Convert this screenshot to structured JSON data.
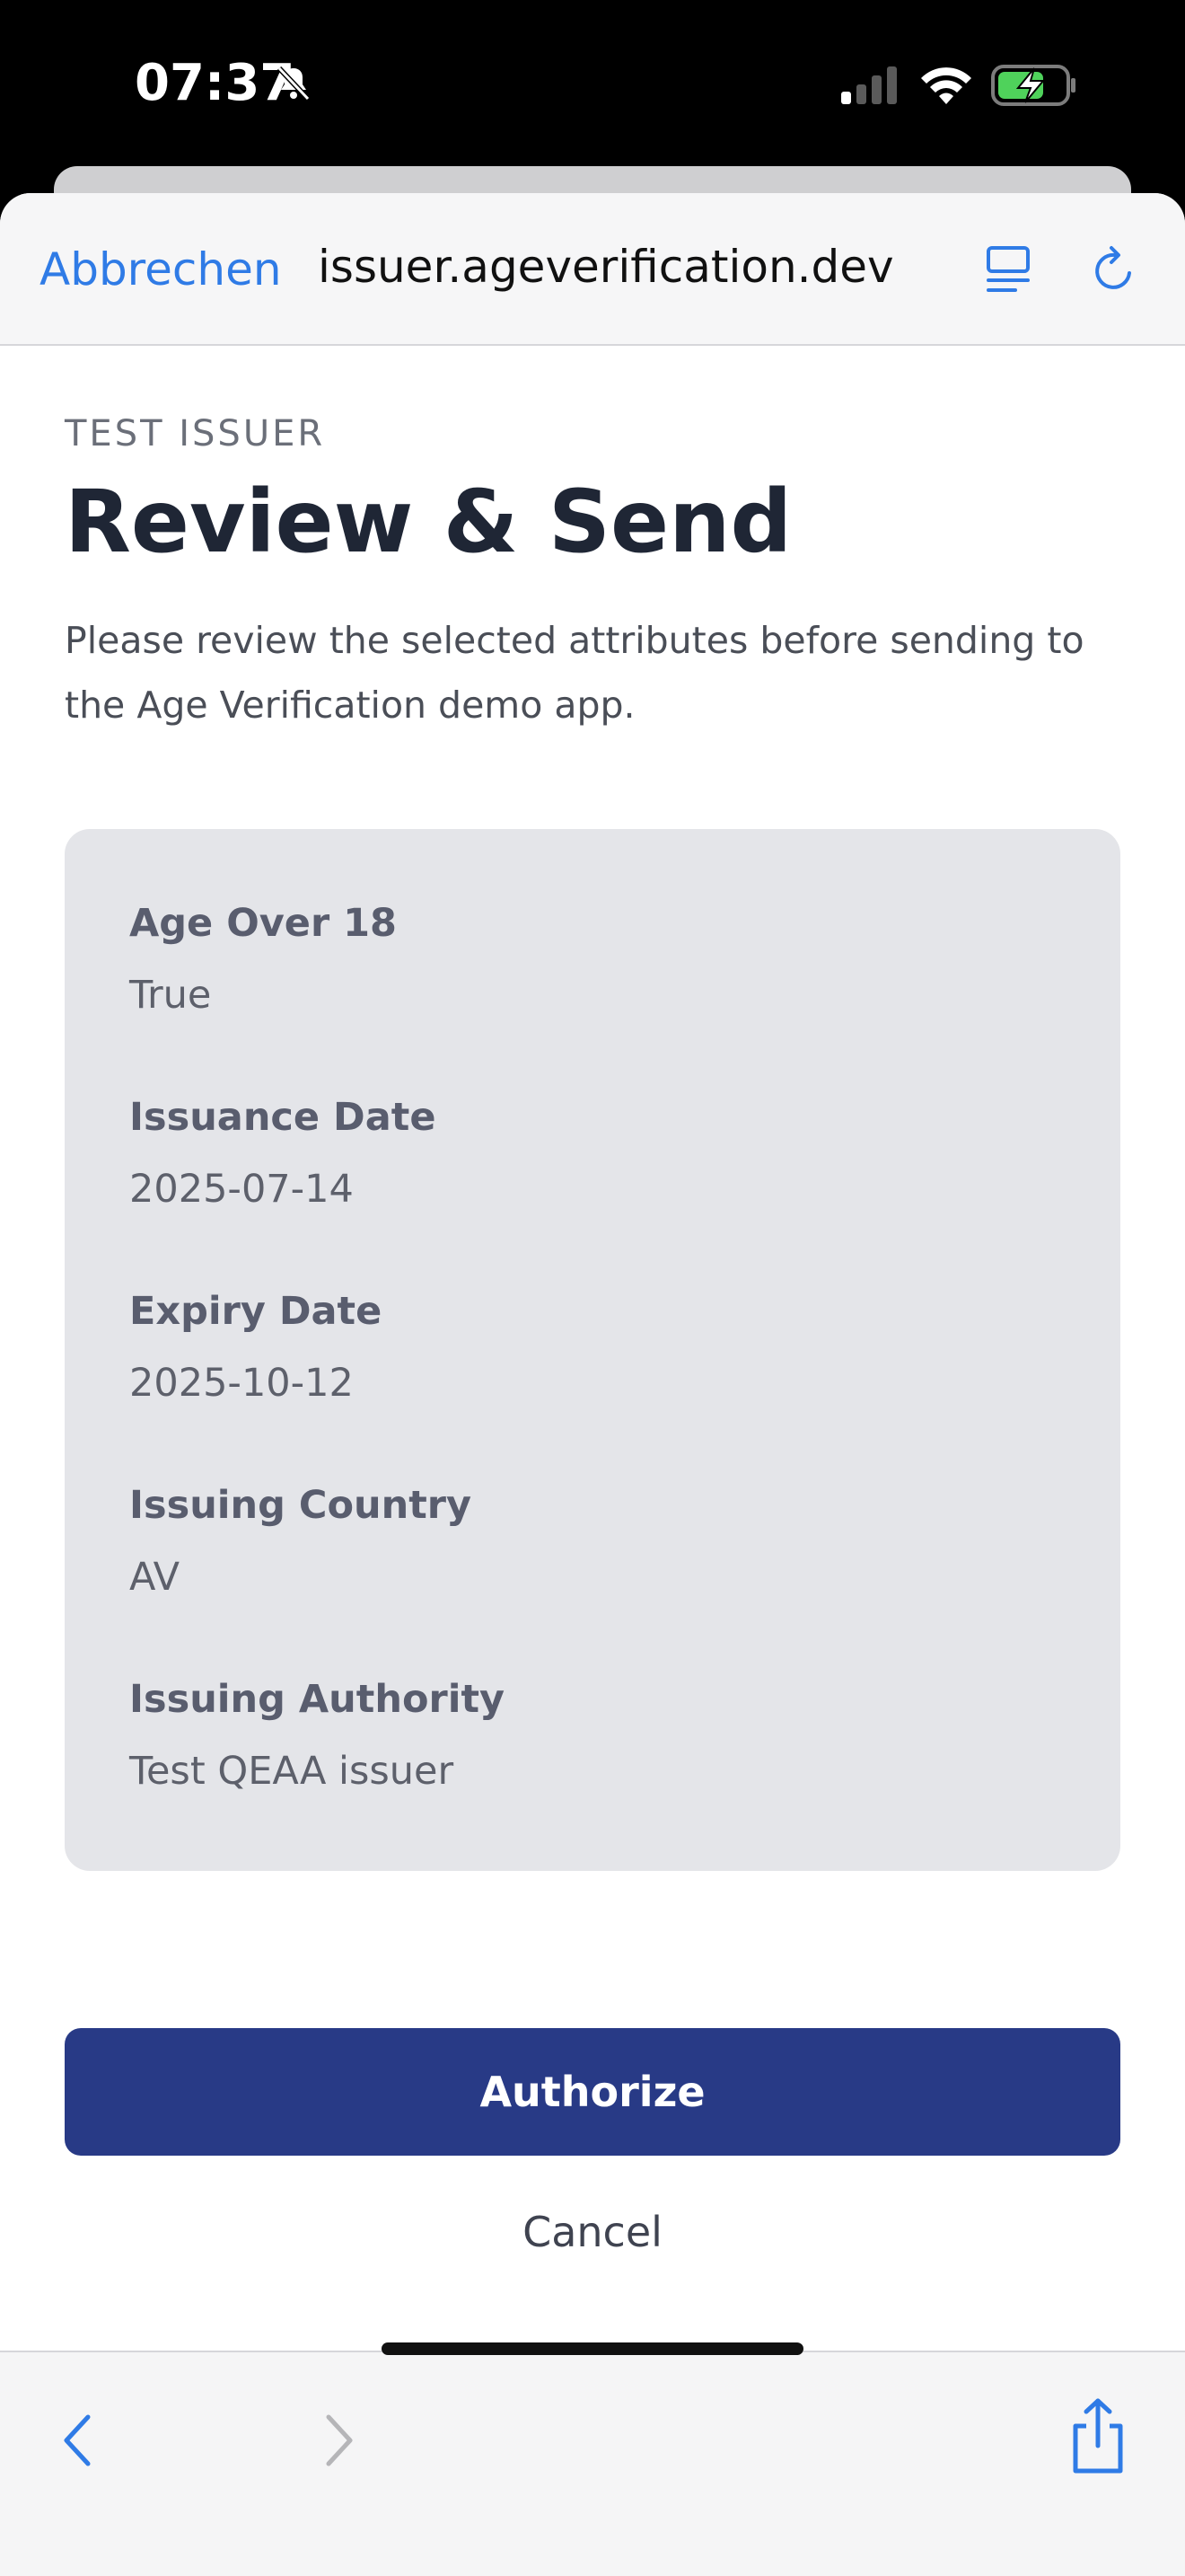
{
  "status_bar": {
    "time": "07:37",
    "icons": [
      "bell-slash-icon",
      "cellular-signal-icon",
      "wifi-icon",
      "battery-charging-icon"
    ]
  },
  "browser": {
    "cancel_label": "Abbrechen",
    "url": "issuer.ageverification.dev",
    "icons": [
      "reader-mode-icon",
      "reload-icon"
    ]
  },
  "page": {
    "eyebrow": "TEST ISSUER",
    "title": "Review & Send",
    "description": "Please review the selected attributes before sending to the Age Verification demo app."
  },
  "attributes": [
    {
      "label": "Age Over 18",
      "value": "True"
    },
    {
      "label": "Issuance Date",
      "value": "2025-07-14"
    },
    {
      "label": "Expiry Date",
      "value": "2025-10-12"
    },
    {
      "label": "Issuing Country",
      "value": "AV"
    },
    {
      "label": "Issuing Authority",
      "value": "Test QEAA issuer"
    }
  ],
  "actions": {
    "authorize_label": "Authorize",
    "cancel_label": "Cancel"
  },
  "toolbar": {
    "icons": [
      "back-chevron-icon",
      "forward-chevron-icon",
      "share-icon"
    ]
  },
  "colors": {
    "accent": "#2f7be6",
    "primary_button": "#283a86",
    "card_bg": "#e4e5e9",
    "title_text": "#1f2635"
  }
}
